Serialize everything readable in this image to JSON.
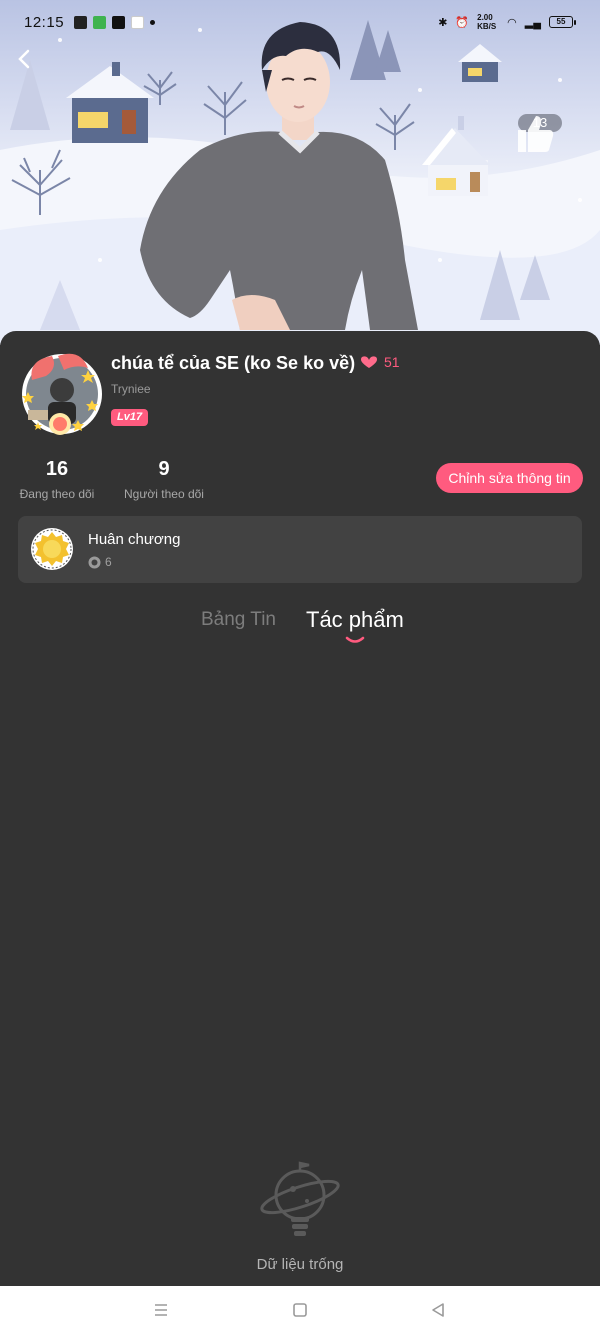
{
  "status_bar": {
    "time": "12:15",
    "network_speed": "2.00 KB/S",
    "battery": "55"
  },
  "hero": {
    "like_count": "13"
  },
  "profile": {
    "name": "chúa tể của SE (ko Se ko về)",
    "heart_level": "51",
    "username": "Tryniee",
    "level_badge": "Lv17"
  },
  "stats": {
    "following_count": "16",
    "following_label": "Đang theo dõi",
    "followers_count": "9",
    "followers_label": "Người theo dõi"
  },
  "edit_button_label": "Chỉnh sửa thông tin",
  "medals": {
    "title": "Huân chương",
    "count": "6"
  },
  "tabs": [
    {
      "label": "Bảng Tin",
      "active": false
    },
    {
      "label": "Tác phẩm",
      "active": true
    }
  ],
  "empty_state": {
    "text": "Dữ liệu trống"
  },
  "colors": {
    "accent": "#ff5b7f",
    "background": "#333333",
    "card": "#424242"
  },
  "icons": [
    "back-arrow-icon",
    "thumbs-up-icon",
    "heart-icon",
    "medal-icon",
    "coin-icon",
    "lightbulb-planet-icon",
    "menu-icon",
    "home-icon",
    "back-triangle-icon"
  ]
}
